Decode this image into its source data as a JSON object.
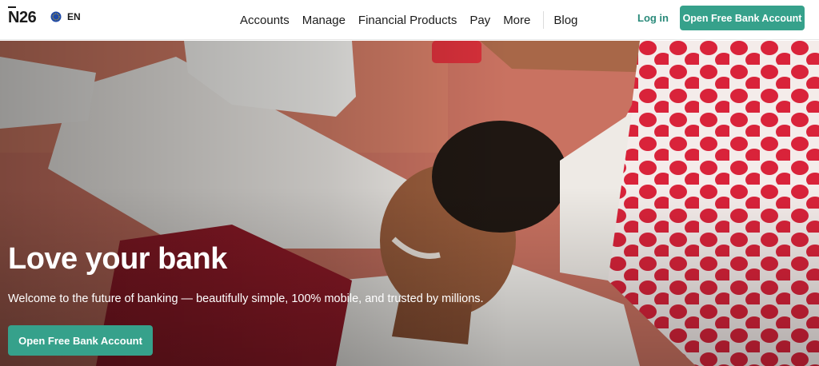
{
  "header": {
    "logo_text": "N26",
    "language": "EN",
    "nav": [
      "Accounts",
      "Manage",
      "Financial Products",
      "Pay",
      "More",
      "Blog"
    ],
    "login_label": "Log in",
    "cta_label": "Open Free Bank Account"
  },
  "hero": {
    "title": "Love your bank",
    "subtitle": "Welcome to the future of banking — beautifully simple, 100% mobile, and trusted by millions.",
    "cta_label": "Open Free Bank Account",
    "image_description_icon": "hero-photo"
  },
  "colors": {
    "accent": "#36a18b",
    "link": "#2a8a7a",
    "text": "#1b1b1b",
    "hero_background": "#c46c56"
  },
  "icons": {
    "language": "globe-icon"
  }
}
